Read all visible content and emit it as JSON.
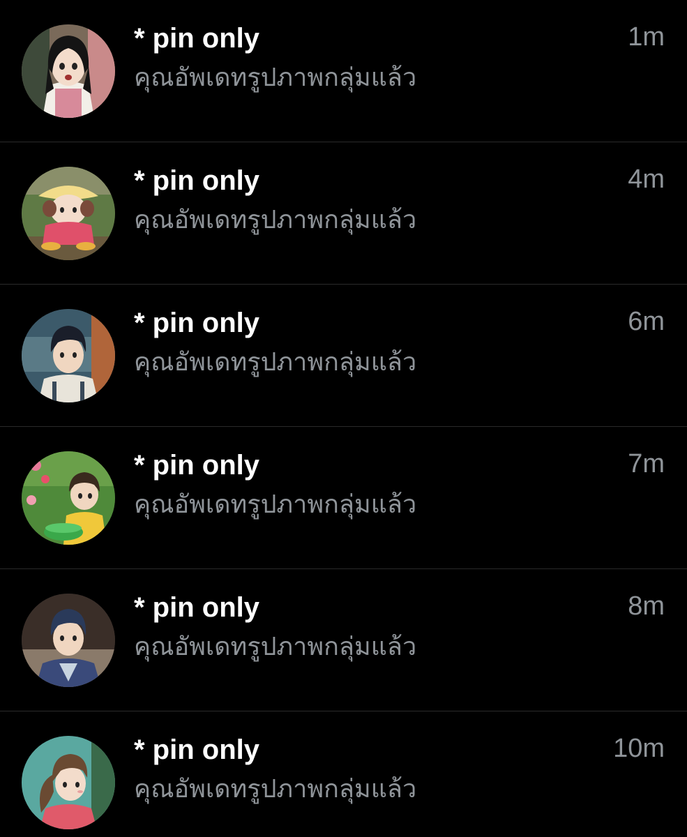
{
  "chats": [
    {
      "title": "* pin only",
      "subtitle": "คุณอัพเดทรูปภาพกลุ่มแล้ว",
      "time": "1m",
      "avatar_icon": "anime-girl-overalls-avatar"
    },
    {
      "title": "* pin only",
      "subtitle": "คุณอัพเดทรูปภาพกลุ่มแล้ว",
      "time": "4m",
      "avatar_icon": "anime-toddler-hat-avatar"
    },
    {
      "title": "* pin only",
      "subtitle": "คุณอัพเดทรูปภาพกลุ่มแล้ว",
      "time": "6m",
      "avatar_icon": "anime-boy-car-avatar"
    },
    {
      "title": "* pin only",
      "subtitle": "คุณอัพเดทรูปภาพกลุ่มแล้ว",
      "time": "7m",
      "avatar_icon": "anime-child-garden-avatar"
    },
    {
      "title": "* pin only",
      "subtitle": "คุณอัพเดทรูปภาพกลุ่มแล้ว",
      "time": "8m",
      "avatar_icon": "anime-boy-jacket-avatar"
    },
    {
      "title": "* pin only",
      "subtitle": "คุณอัพเดทรูปภาพกลุ่มแล้ว",
      "time": "10m",
      "avatar_icon": "anime-girl-ponytail-avatar"
    }
  ],
  "colors": {
    "background": "#000000",
    "title": "#ffffff",
    "secondary": "#8f9499",
    "divider": "#2a2a2a"
  }
}
